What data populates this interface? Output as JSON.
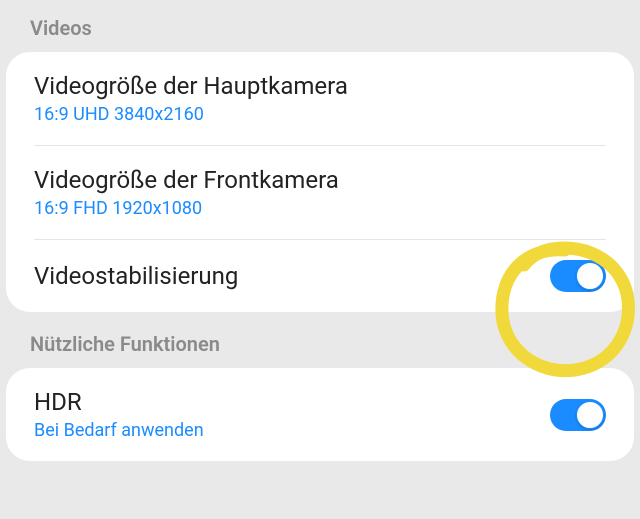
{
  "sections": [
    {
      "header": "Videos",
      "rows": [
        {
          "title": "Videogröße der Hauptkamera",
          "subtitle": "16:9 UHD 3840x2160",
          "toggle": null
        },
        {
          "title": "Videogröße der Frontkamera",
          "subtitle": "16:9 FHD 1920x1080",
          "toggle": null
        },
        {
          "title": "Videostabilisierung",
          "subtitle": null,
          "toggle": true
        }
      ]
    },
    {
      "header": "Nützliche Funktionen",
      "rows": [
        {
          "title": "HDR",
          "subtitle": "Bei Bedarf anwenden",
          "toggle": true
        }
      ]
    }
  ],
  "annotation": "circle-highlight"
}
